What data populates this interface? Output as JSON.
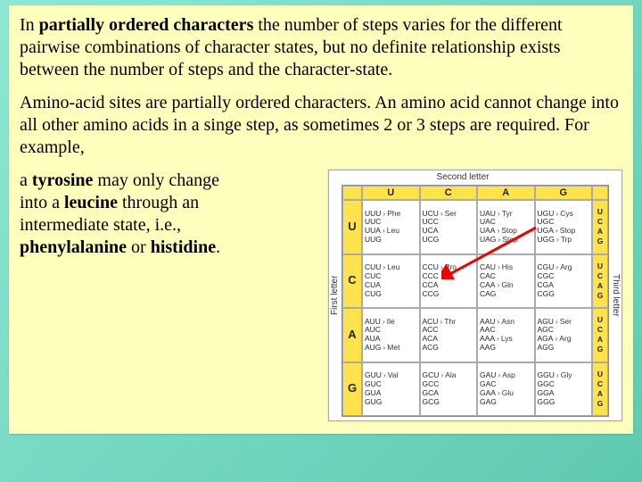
{
  "para1_prefix": "In ",
  "para1_bold": "partially ordered characters",
  "para1_rest": " the number of steps varies for the different pairwise combinations of character states, but no definite relationship exists between the number of steps and the character-state.",
  "para2": "Amino-acid sites are partially ordered characters. An amino acid cannot change into all other amino acids in a singe step, as sometimes 2 or 3 steps are required. For example,",
  "wrap_l1a": "a ",
  "wrap_l1b": "tyrosine",
  "wrap_l1c": " may only change",
  "wrap_l2a": "into a ",
  "wrap_l2b": "leucine",
  "wrap_l2c": " through an",
  "wrap_l3": "intermediate state, i.e., ",
  "wrap_l4a": "phenylalanine",
  "wrap_l4b": " or ",
  "wrap_l4c": "histidine",
  "wrap_l4d": ".",
  "table": {
    "top_label": "Second letter",
    "left_label": "First letter",
    "right_label": "Third letter",
    "cols": [
      "U",
      "C",
      "A",
      "G"
    ],
    "rows": [
      "U",
      "C",
      "A",
      "G"
    ],
    "third": [
      "U",
      "C",
      "A",
      "G"
    ],
    "cells": {
      "U": {
        "U": [
          [
            "UUU",
            "Phe"
          ],
          [
            "UUC",
            ""
          ],
          [
            "UUA",
            "Leu"
          ],
          [
            "UUG",
            ""
          ]
        ],
        "C": [
          [
            "UCU",
            "Ser"
          ],
          [
            "UCC",
            ""
          ],
          [
            "UCA",
            ""
          ],
          [
            "UCG",
            ""
          ]
        ],
        "A": [
          [
            "UAU",
            "Tyr"
          ],
          [
            "UAC",
            ""
          ],
          [
            "UAA",
            "Stop"
          ],
          [
            "UAG",
            "Stop"
          ]
        ],
        "G": [
          [
            "UGU",
            "Cys"
          ],
          [
            "UGC",
            ""
          ],
          [
            "UGA",
            "Stop"
          ],
          [
            "UGG",
            "Trp"
          ]
        ]
      },
      "C": {
        "U": [
          [
            "CUU",
            "Leu"
          ],
          [
            "CUC",
            ""
          ],
          [
            "CUA",
            ""
          ],
          [
            "CUG",
            ""
          ]
        ],
        "C": [
          [
            "CCU",
            "Pro"
          ],
          [
            "CCC",
            ""
          ],
          [
            "CCA",
            ""
          ],
          [
            "CCG",
            ""
          ]
        ],
        "A": [
          [
            "CAU",
            "His"
          ],
          [
            "CAC",
            ""
          ],
          [
            "CAA",
            "Gln"
          ],
          [
            "CAG",
            ""
          ]
        ],
        "G": [
          [
            "CGU",
            "Arg"
          ],
          [
            "CGC",
            ""
          ],
          [
            "CGA",
            ""
          ],
          [
            "CGG",
            ""
          ]
        ]
      },
      "A": {
        "U": [
          [
            "AUU",
            "Ile"
          ],
          [
            "AUC",
            ""
          ],
          [
            "AUA",
            ""
          ],
          [
            "AUG",
            "Met"
          ]
        ],
        "C": [
          [
            "ACU",
            "Thr"
          ],
          [
            "ACC",
            ""
          ],
          [
            "ACA",
            ""
          ],
          [
            "ACG",
            ""
          ]
        ],
        "A": [
          [
            "AAU",
            "Asn"
          ],
          [
            "AAC",
            ""
          ],
          [
            "AAA",
            "Lys"
          ],
          [
            "AAG",
            ""
          ]
        ],
        "G": [
          [
            "AGU",
            "Ser"
          ],
          [
            "AGC",
            ""
          ],
          [
            "AGA",
            "Arg"
          ],
          [
            "AGG",
            ""
          ]
        ]
      },
      "G": {
        "U": [
          [
            "GUU",
            "Val"
          ],
          [
            "GUC",
            ""
          ],
          [
            "GUA",
            ""
          ],
          [
            "GUG",
            ""
          ]
        ],
        "C": [
          [
            "GCU",
            "Ala"
          ],
          [
            "GCC",
            ""
          ],
          [
            "GCA",
            ""
          ],
          [
            "GCG",
            ""
          ]
        ],
        "A": [
          [
            "GAU",
            "Asp"
          ],
          [
            "GAC",
            ""
          ],
          [
            "GAA",
            "Glu"
          ],
          [
            "GAG",
            ""
          ]
        ],
        "G": [
          [
            "GGU",
            "Gly"
          ],
          [
            "GGC",
            ""
          ],
          [
            "GGA",
            ""
          ],
          [
            "GGG",
            ""
          ]
        ]
      }
    }
  }
}
